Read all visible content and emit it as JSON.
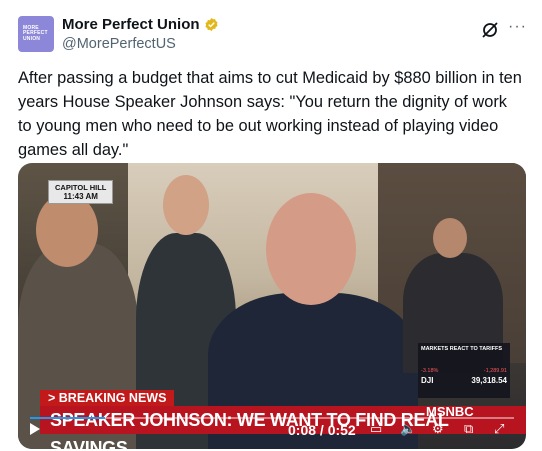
{
  "author": {
    "name": "More Perfect Union",
    "handle": "@MorePerfectUS",
    "avatar_lines": [
      "MORE",
      "PERFECT",
      "UNION"
    ],
    "avatar_color": "#8c87d8",
    "verified_icon": "gold-verified-badge-icon"
  },
  "header_actions": {
    "grok_icon": "grok-icon",
    "more_label": "···"
  },
  "tweet": {
    "text": "After passing a budget that aims to cut Medicaid by $880 billion in ten years House Speaker Johnson says: \"You return the dignity of work to young men who need to be out working instead of playing video games all day.\""
  },
  "video": {
    "location_badge": "CAPITOL HILL",
    "location_time": "11:43 AM",
    "breaking_label": "> BREAKING NEWS",
    "headline": "SPEAKER JOHNSON: WE WANT TO FIND REAL SAVINGS",
    "network": "MSNBC",
    "markets": {
      "title": "MARKETS REACT TO TARIFFS",
      "left_change": "-3.18%",
      "right_change": "-1,289.91",
      "index": "DJI",
      "index_value": "39,318.54"
    },
    "time_display": "0:08 / 0:52",
    "progress": 0.154,
    "colors": {
      "accent": "#1d9bf0",
      "breaking_red": "#c21a1a"
    }
  }
}
